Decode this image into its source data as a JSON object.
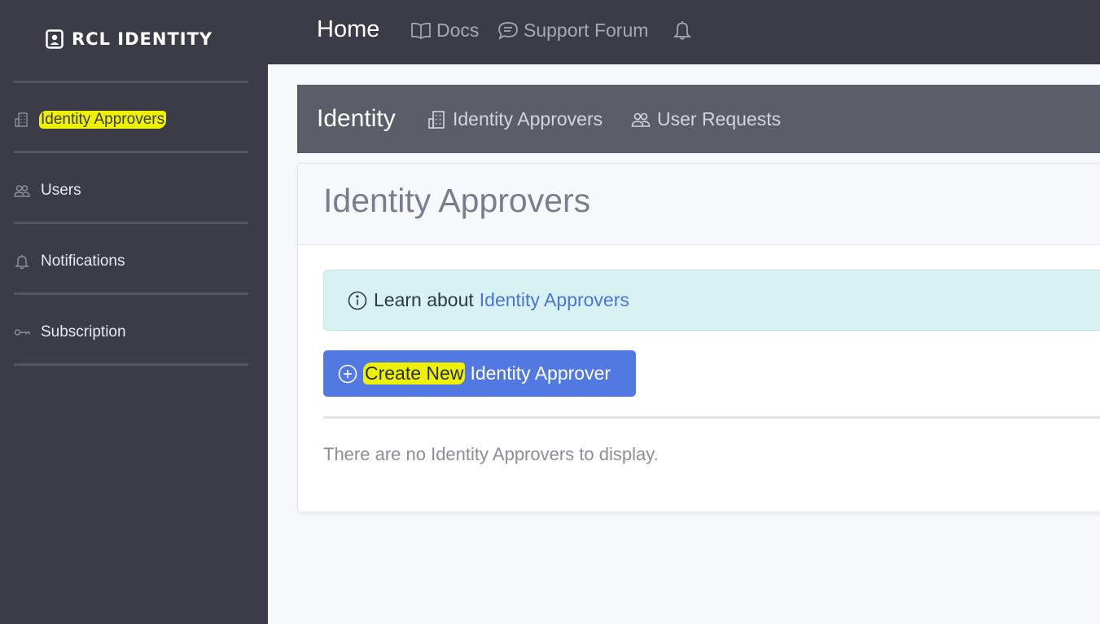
{
  "brand": {
    "name": "RCL IDENTITY",
    "icon": "id-badge-icon"
  },
  "sidebar": {
    "items": [
      {
        "label": "Identity Approvers",
        "icon": "building-icon",
        "highlighted": true
      },
      {
        "label": "Users",
        "icon": "users-icon"
      },
      {
        "label": "Notifications",
        "icon": "bell-icon"
      },
      {
        "label": "Subscription",
        "icon": "key-icon"
      }
    ]
  },
  "topbar": {
    "home": "Home",
    "links": [
      {
        "label": "Docs",
        "icon": "book-icon"
      },
      {
        "label": "Support Forum",
        "icon": "chat-icon"
      }
    ],
    "bell_icon": "bell-icon"
  },
  "subnav": {
    "title": "Identity",
    "links": [
      {
        "label": "Identity Approvers",
        "icon": "building-icon"
      },
      {
        "label": "User Requests",
        "icon": "users-icon"
      }
    ]
  },
  "card": {
    "title": "Identity Approvers",
    "alert": {
      "prefix": "Learn about",
      "link": "Identity Approvers",
      "icon": "info-circle-icon"
    },
    "create_button": {
      "highlight": "Create New",
      "rest": "Identity Approver",
      "icon": "plus-circle-icon"
    },
    "empty_message": "There are no Identity Approvers to display."
  },
  "colors": {
    "sidebar_bg": "#3b3c47",
    "subnav_bg": "#5b5d69",
    "primary": "#5279e1",
    "alert_bg": "#d8f1f3",
    "highlight": "#eef200"
  }
}
